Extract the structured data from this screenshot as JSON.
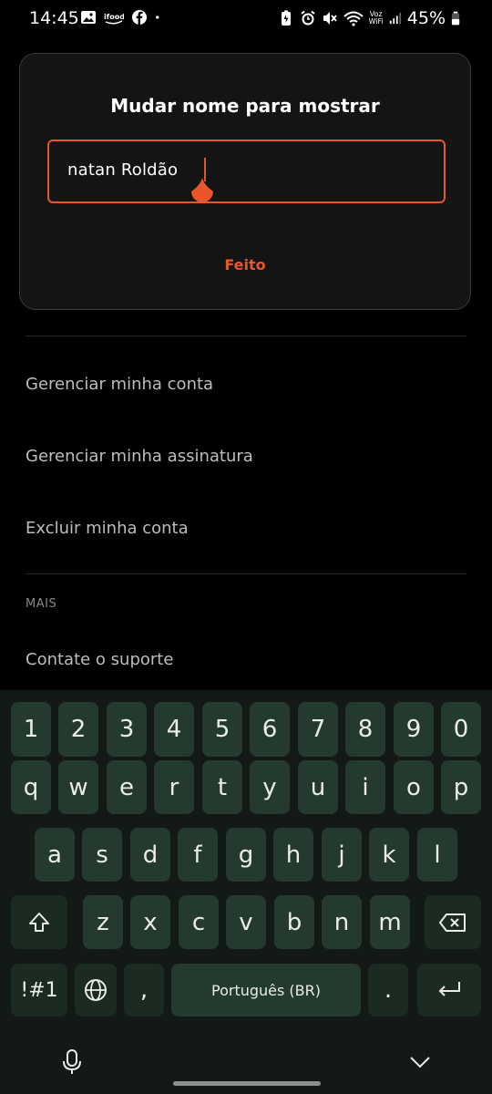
{
  "status_bar": {
    "time": "14:45",
    "voz_label": "Voz",
    "wifi_label": "WiFi",
    "battery_percent": "45%",
    "icons": [
      "gallery-icon",
      "ifood-icon",
      "facebook-icon",
      "dot-icon",
      "battery-saver-icon",
      "alarm-icon",
      "mute-icon",
      "wifi-icon",
      "signal-icon",
      "battery-icon"
    ]
  },
  "dialog": {
    "title": "Mudar nome para mostrar",
    "input_value": "natan Roldão",
    "done_label": "Feito",
    "accent": "#e8572a"
  },
  "menu": {
    "items": [
      "Gerenciar minha conta",
      "Gerenciar minha assinatura",
      "Excluir minha conta"
    ],
    "section_label": "MAIS",
    "support_label": "Contate o suporte"
  },
  "keyboard": {
    "row_numbers": [
      "1",
      "2",
      "3",
      "4",
      "5",
      "6",
      "7",
      "8",
      "9",
      "0"
    ],
    "row1": [
      "q",
      "w",
      "e",
      "r",
      "t",
      "y",
      "u",
      "i",
      "o",
      "p"
    ],
    "row2": [
      "a",
      "s",
      "d",
      "f",
      "g",
      "h",
      "j",
      "k",
      "l"
    ],
    "row3": [
      "z",
      "x",
      "c",
      "v",
      "b",
      "n",
      "m"
    ],
    "symbols_label": "!#1",
    "comma_label": ",",
    "space_label": "Português (BR)",
    "period_label": "."
  }
}
